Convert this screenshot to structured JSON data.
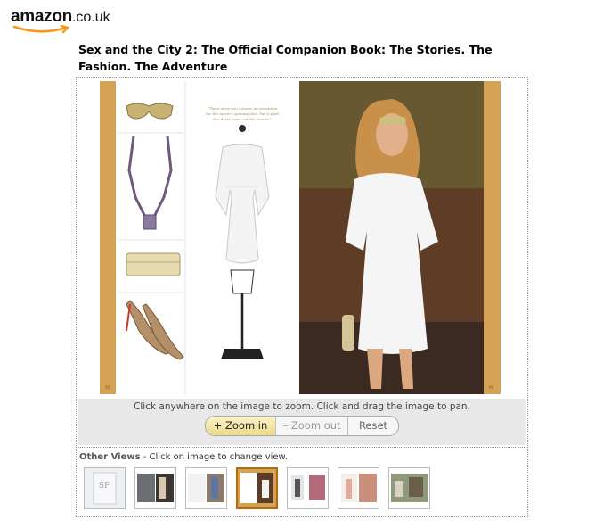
{
  "logo": {
    "word": "amazon",
    "tld": ".co.uk"
  },
  "title": "Sex and the City 2: The Official Companion Book: The Stories. The Fashion. The Adventure",
  "viewer": {
    "hint": "Click anywhere on the image to zoom. Click and drag the image to pan.",
    "zoom_in": "+ Zoom in",
    "zoom_out": "– Zoom out",
    "reset": "Reset"
  },
  "other_views": {
    "label_bold": "Other Views",
    "label_rest": " - Click on image to change view.",
    "thumbnails": [
      {
        "name": "thumb-cover"
      },
      {
        "name": "thumb-view-2"
      },
      {
        "name": "thumb-view-3"
      },
      {
        "name": "thumb-view-4",
        "selected": true
      },
      {
        "name": "thumb-view-5"
      },
      {
        "name": "thumb-view-6"
      },
      {
        "name": "thumb-view-7"
      }
    ]
  },
  "colors": {
    "accent_gold": "#d4a253",
    "selected_border": "#b36a12",
    "strip_bg": "#e8e8e8"
  }
}
